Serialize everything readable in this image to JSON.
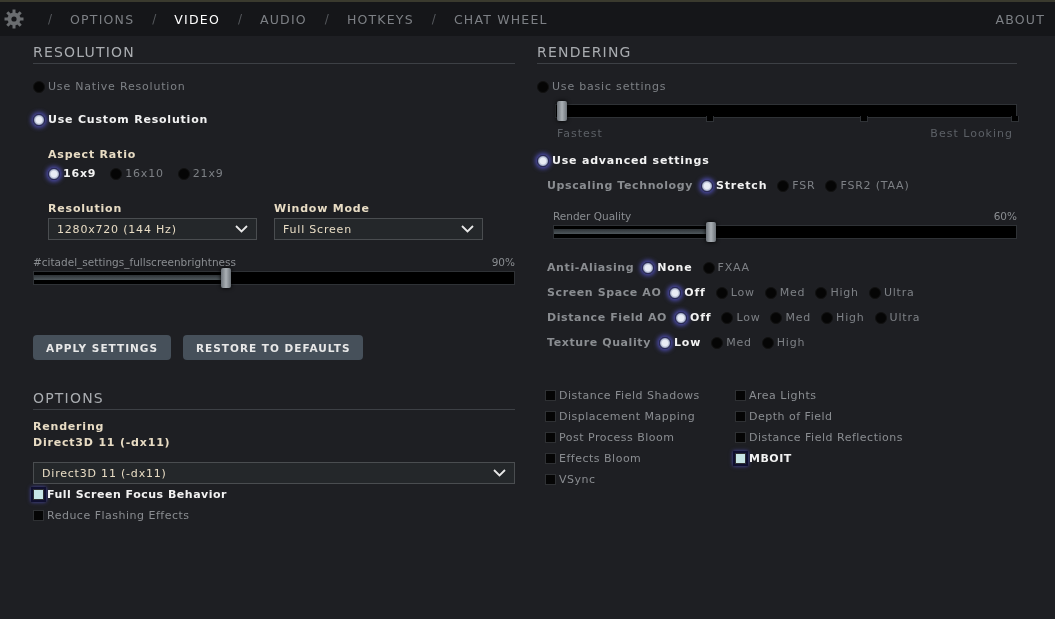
{
  "nav": {
    "tabs": [
      {
        "separator": "/",
        "label": "OPTIONS",
        "selected": false
      },
      {
        "separator": "/",
        "label": "VIDEO",
        "selected": true
      },
      {
        "separator": "/",
        "label": "AUDIO",
        "selected": false
      },
      {
        "separator": "/",
        "label": "HOTKEYS",
        "selected": false
      },
      {
        "separator": "/",
        "label": "CHAT WHEEL",
        "selected": false
      }
    ],
    "about": "ABOUT"
  },
  "resolution": {
    "title": "RESOLUTION",
    "modes": [
      {
        "label": "Use Native Resolution",
        "selected": false
      },
      {
        "label": "Use Custom Resolution",
        "selected": true
      }
    ],
    "aspect_ratio": {
      "label": "Aspect Ratio",
      "options": [
        {
          "label": "16x9",
          "selected": true
        },
        {
          "label": "16x10",
          "selected": false
        },
        {
          "label": "21x9",
          "selected": false
        }
      ]
    },
    "resolution_select": {
      "label": "Resolution",
      "value": "1280x720 (144 Hz)"
    },
    "window_mode": {
      "label": "Window Mode",
      "value": "Full Screen"
    },
    "brightness": {
      "label": "#citadel_settings_fullscreenbrightness",
      "reading": "90%",
      "level": 0.4
    }
  },
  "buttons": [
    "APPLY SETTINGS",
    "RESTORE TO DEFAULTS"
  ],
  "options": {
    "title": "OPTIONS",
    "rendering_label": "Rendering",
    "rendering_value": "Direct3D 11 (-dx11)",
    "select_value": "Direct3D 11 (-dx11)",
    "checkboxes": [
      {
        "label": "Full Screen Focus Behavior",
        "checked": true
      },
      {
        "label": "Reduce Flashing Effects",
        "checked": false
      }
    ]
  },
  "rendering": {
    "title": "RENDERING",
    "basic": {
      "label": "Use basic settings",
      "selected": false,
      "level": 0,
      "low_label": "Fastest",
      "high_label": "Best Looking"
    },
    "advanced": {
      "label": "Use advanced settings",
      "selected": true
    },
    "upscaling": {
      "label": "Upscaling Technology",
      "options": [
        {
          "label": "Stretch",
          "selected": true
        },
        {
          "label": "FSR",
          "selected": false
        },
        {
          "label": "FSR2 (TAA)",
          "selected": false
        }
      ]
    },
    "render_quality": {
      "label": "Render Quality",
      "reading": "60%",
      "level": 0.34
    },
    "rows": [
      {
        "label": "Anti-Aliasing",
        "options": [
          {
            "label": "None",
            "selected": true
          },
          {
            "label": "FXAA",
            "selected": false
          }
        ]
      },
      {
        "label": "Screen Space AO",
        "options": [
          {
            "label": "Off",
            "selected": true
          },
          {
            "label": "Low",
            "selected": false
          },
          {
            "label": "Med",
            "selected": false
          },
          {
            "label": "High",
            "selected": false
          },
          {
            "label": "Ultra",
            "selected": false
          }
        ]
      },
      {
        "label": "Distance Field AO",
        "options": [
          {
            "label": "Off",
            "selected": true
          },
          {
            "label": "Low",
            "selected": false
          },
          {
            "label": "Med",
            "selected": false
          },
          {
            "label": "High",
            "selected": false
          },
          {
            "label": "Ultra",
            "selected": false
          }
        ]
      },
      {
        "label": "Texture Quality",
        "options": [
          {
            "label": "Low",
            "selected": true
          },
          {
            "label": "Med",
            "selected": false
          },
          {
            "label": "High",
            "selected": false
          }
        ]
      }
    ],
    "toggles": [
      {
        "label": "Distance Field Shadows",
        "checked": false
      },
      {
        "label": "Displacement Mapping",
        "checked": false
      },
      {
        "label": "Post Process Bloom",
        "checked": false
      },
      {
        "label": "Effects Bloom",
        "checked": false
      },
      {
        "label": "VSync",
        "checked": false
      },
      {
        "label": "Area Lights",
        "checked": false
      },
      {
        "label": "Depth of Field",
        "checked": false
      },
      {
        "label": "Distance Field Reflections",
        "checked": false
      },
      {
        "label": "MBOIT",
        "checked": true
      }
    ]
  }
}
